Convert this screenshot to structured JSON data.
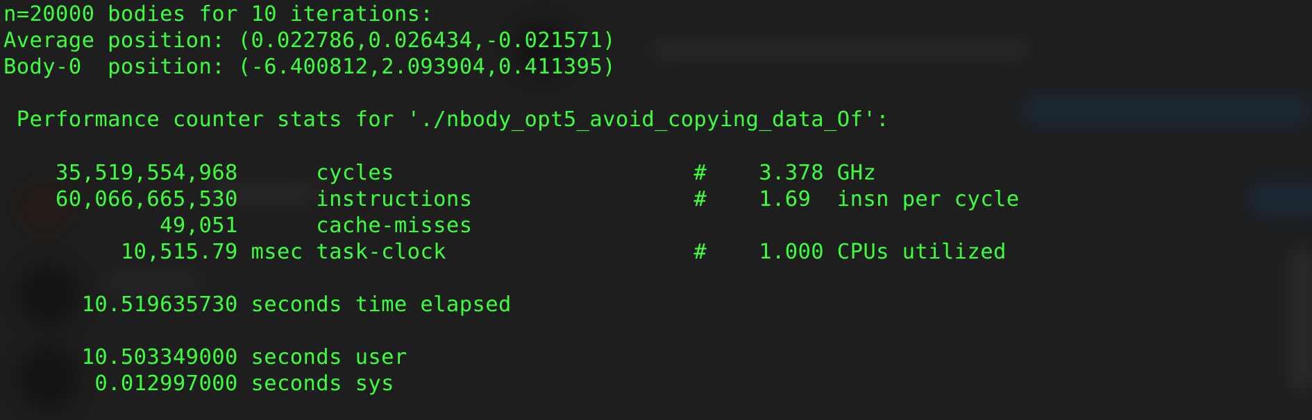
{
  "terminal": {
    "lines": [
      "n=20000 bodies for 10 iterations:",
      "Average position: (0.022786,0.026434,-0.021571)",
      "Body-0  position: (-6.400812,2.093904,0.411395)",
      "",
      " Performance counter stats for './nbody_opt5_avoid_copying_data_Of':",
      "",
      "    35,519,554,968      cycles                       #    3.378 GHz",
      "    60,066,665,530      instructions                 #    1.69  insn per cycle",
      "            49,051      cache-misses",
      "         10,515.79 msec task-clock                   #    1.000 CPUs utilized",
      "",
      "      10.519635730 seconds time elapsed",
      "",
      "      10.503349000 seconds user",
      "       0.012997000 seconds sys"
    ]
  },
  "colors": {
    "background": "#1e1e1e",
    "text": "#3cff3c"
  }
}
